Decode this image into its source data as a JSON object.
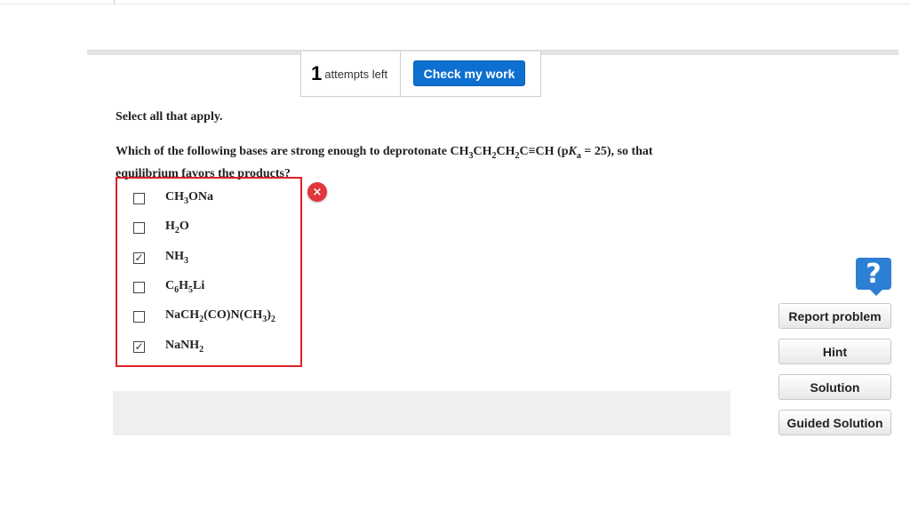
{
  "attempts": {
    "count": "1",
    "label": "attempts left"
  },
  "check_button": "Check my work",
  "instruction": "Select all that apply.",
  "question": {
    "parts": [
      "Which of the following bases are strong enough to deprotonate CH",
      "3",
      "CH",
      "2",
      "CH",
      "2",
      "C≡CH (p",
      "K",
      "a",
      " = 25), so that",
      "equilibrium favors the products?"
    ]
  },
  "choices": [
    {
      "parts": [
        "CH",
        "3",
        "ONa",
        "",
        ""
      ],
      "checked": false
    },
    {
      "parts": [
        "H",
        "2",
        "O",
        "",
        ""
      ],
      "checked": false
    },
    {
      "parts": [
        "NH",
        "3",
        "",
        "",
        ""
      ],
      "checked": true
    },
    {
      "parts": [
        "C",
        "6",
        "H",
        "5",
        "Li"
      ],
      "checked": false
    },
    {
      "parts": [
        "NaCH",
        "2",
        "(CO)N(CH",
        "3",
        ")",
        "2"
      ],
      "checked": false
    },
    {
      "parts": [
        "NaNH",
        "2",
        "",
        "",
        ""
      ],
      "checked": true
    }
  ],
  "check_glyph": "✓",
  "feedback": {
    "icon": "x-circle-icon",
    "glyph": "×",
    "color": "#e0363c"
  },
  "help": {
    "icon": "question-icon",
    "glyph": "?"
  },
  "side_buttons": [
    "Report problem",
    "Hint",
    "Solution",
    "Guided Solution"
  ]
}
